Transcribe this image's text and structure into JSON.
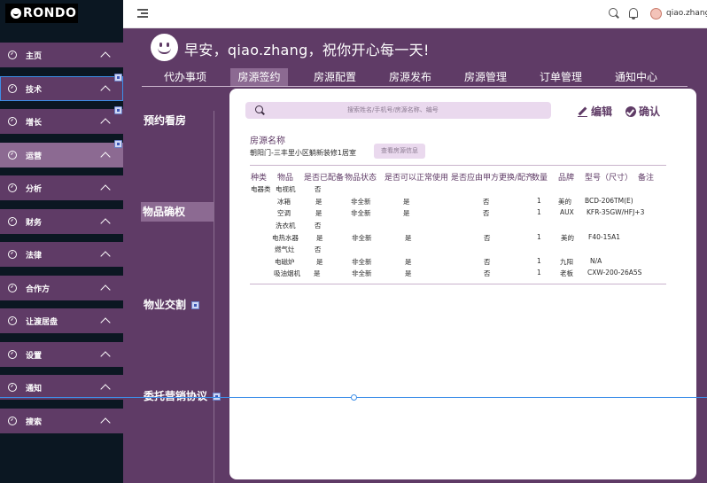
{
  "brand": {
    "logo_text": "RONDO"
  },
  "topbar": {
    "username": "qiao.zhang"
  },
  "sidebar": {
    "items": [
      {
        "label": "主页"
      },
      {
        "label": "技术"
      },
      {
        "label": "增长"
      },
      {
        "label": "运营"
      },
      {
        "label": "分析"
      },
      {
        "label": "财务"
      },
      {
        "label": "法律"
      },
      {
        "label": "合作方"
      },
      {
        "label": "让渡居盘"
      },
      {
        "label": "设置"
      },
      {
        "label": "通知"
      },
      {
        "label": "搜索"
      }
    ]
  },
  "greeting": "早安，qiao.zhang，祝你开心每一天!",
  "tabs": [
    "代办事项",
    "房源签约",
    "房源配置",
    "房源发布",
    "房源管理",
    "订单管理",
    "通知中心"
  ],
  "steps": [
    "预约看房",
    "物品确权",
    "物业交割",
    "委托营销协议"
  ],
  "panel": {
    "search_placeholder": "搜索姓名/手机号/房源名称、编号",
    "edit_label": "编辑",
    "confirm_label": "确认",
    "property_label": "房源名称",
    "property_value": "朝阳门-三丰里小区躺新装修1居室",
    "property_button": "查看房源信息"
  },
  "table": {
    "headers": [
      "种类",
      "物品",
      "是否已配备",
      "物品状态",
      "是否可以正常使用",
      "是否应由甲方更换/配齐",
      "数量",
      "品牌",
      "型号（尺寸）",
      "备注"
    ],
    "rows": [
      [
        "电器类",
        "电视机",
        "否",
        "",
        "",
        "",
        "",
        "",
        "",
        ""
      ],
      [
        "",
        "冰箱",
        "是",
        "非全新",
        "是",
        "否",
        "1",
        "美的",
        "BCD-206TM(E)",
        ""
      ],
      [
        "",
        "空调",
        "是",
        "非全新",
        "是",
        "否",
        "1",
        "AUX",
        "KFR-35GW/HFJ+3",
        ""
      ],
      [
        "",
        "洗衣机",
        "否",
        "",
        "",
        "",
        "",
        "",
        "",
        ""
      ],
      [
        "",
        "电热水器",
        "是",
        "非全新",
        "是",
        "否",
        "1",
        "美的",
        "F40-15A1",
        ""
      ],
      [
        "",
        "燃气灶",
        "否",
        "",
        "",
        "",
        "",
        "",
        "",
        ""
      ],
      [
        "",
        "电磁炉",
        "是",
        "非全新",
        "是",
        "否",
        "1",
        "九阳",
        "N/A",
        ""
      ],
      [
        "",
        "吸油烟机",
        "是",
        "非全新",
        "是",
        "否",
        "1",
        "老板",
        "CXW-200-26A5S",
        ""
      ]
    ]
  },
  "colors": {
    "primary": "#5f3b66",
    "active": "#8c6a92",
    "sidebar_bg": "#0b1722",
    "accent_light": "#ead9ee",
    "guide": "#3d8ee8"
  }
}
